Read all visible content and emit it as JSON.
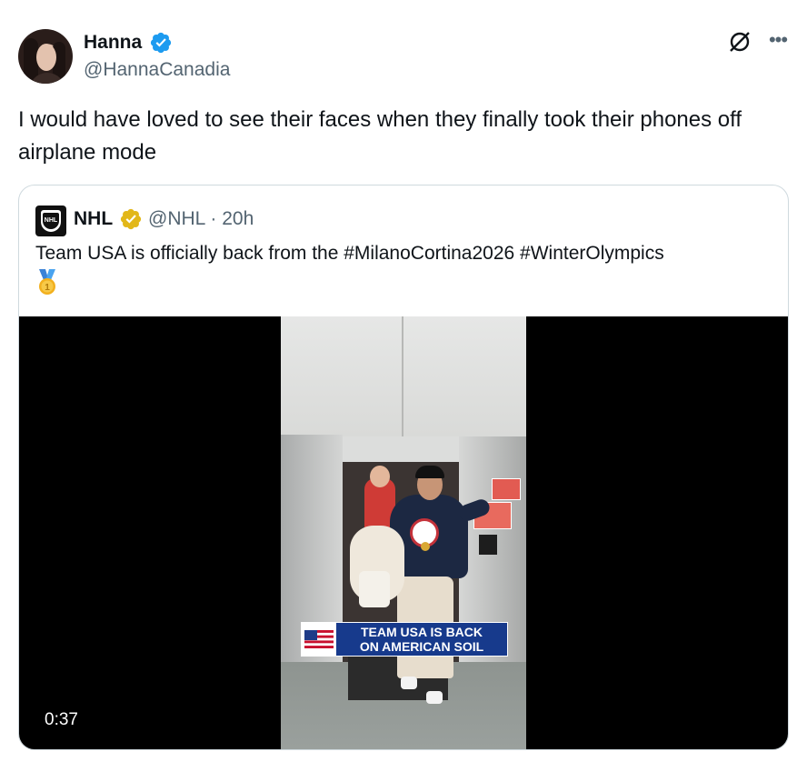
{
  "tweet": {
    "author": {
      "display_name": "Hanna",
      "handle": "@HannaCanadia",
      "verified_color": "#1d9bf0"
    },
    "text": "I would have loved to see their faces when they finally took their phones off airplane mode",
    "icons": [
      "grok-icon",
      "more-icon"
    ]
  },
  "quote": {
    "author": {
      "display_name": "NHL",
      "handle_time": "@NHL · 20h",
      "verified_color": "#e2b719"
    },
    "text": "Team USA is officially back from the #MilanoCortina2026 #WinterOlympics",
    "emoji_icon": "gold-medal-icon",
    "video": {
      "caption_line1": "TEAM USA IS BACK",
      "caption_line2": "ON AMERICAN SOIL",
      "duration": "0:37",
      "caption_color": "#173a8c"
    }
  },
  "colors": {
    "text_primary": "#0f1419",
    "text_secondary": "#536471",
    "border": "#cfd9de"
  }
}
